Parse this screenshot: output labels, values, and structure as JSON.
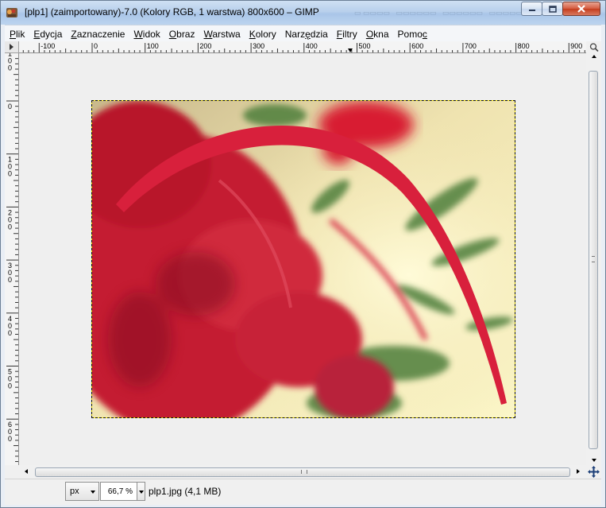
{
  "window": {
    "title": "[plp1] (zaimportowany)-7.0 (Kolory RGB, 1 warstwa) 800x600 – GIMP",
    "icon": "gimp-icon",
    "controls": [
      "minimize-icon",
      "maximize-icon",
      "close-icon"
    ]
  },
  "menu": [
    {
      "id": "plik",
      "pre": "",
      "u": "P",
      "post": "lik"
    },
    {
      "id": "edycja",
      "pre": "",
      "u": "E",
      "post": "dycja"
    },
    {
      "id": "zaznaczenie",
      "pre": "",
      "u": "Z",
      "post": "aznaczenie"
    },
    {
      "id": "widok",
      "pre": "",
      "u": "W",
      "post": "idok"
    },
    {
      "id": "obraz",
      "pre": "",
      "u": "O",
      "post": "braz"
    },
    {
      "id": "warstwa",
      "pre": "",
      "u": "W",
      "post": "arstwa"
    },
    {
      "id": "kolory",
      "pre": "",
      "u": "K",
      "post": "olory"
    },
    {
      "id": "narzedzia",
      "pre": "Narz",
      "u": "ę",
      "post": "dzia"
    },
    {
      "id": "filtry",
      "pre": "",
      "u": "F",
      "post": "iltry"
    },
    {
      "id": "okna",
      "pre": "",
      "u": "O",
      "post": "kna"
    },
    {
      "id": "pomoc",
      "pre": "Pomo",
      "u": "c",
      "post": ""
    }
  ],
  "ruler": {
    "horizontal_labels": [
      "-100",
      "0",
      "100",
      "200",
      "300",
      "400",
      "500",
      "600",
      "700",
      "800",
      "900"
    ],
    "vertical_labels": [
      "100",
      "0",
      "100",
      "200",
      "300",
      "400",
      "500",
      "600"
    ]
  },
  "image": {
    "description_colors": {
      "red": "#cc1f3a",
      "cream": "#f4eec0",
      "green": "#4f7a3a"
    }
  },
  "statusbar": {
    "unit": "px",
    "zoom": "66,7 %",
    "file_info": "plp1.jpg (4,1 MB)"
  },
  "icons": {
    "quickmask": "quick-mask-icon",
    "navigate": "navigate-icon"
  }
}
